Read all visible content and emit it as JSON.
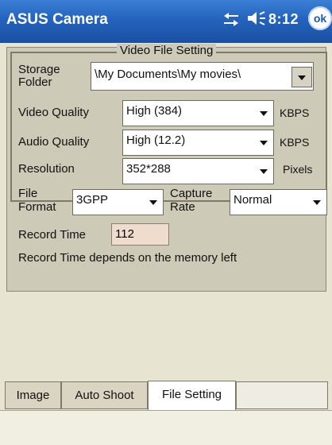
{
  "titlebar": {
    "app_title": "ASUS Camera",
    "clock": "8:12",
    "ok_label": "ok"
  },
  "section_title": "Video File Setting",
  "storage": {
    "label_line1": "Storage",
    "label_line2": "Folder",
    "value": "\\My Documents\\My movies\\"
  },
  "video_quality": {
    "label": "Video Quality",
    "value": "High (384)",
    "unit": "KBPS"
  },
  "audio_quality": {
    "label": "Audio Quality",
    "value": "High (12.2)",
    "unit": "KBPS"
  },
  "resolution": {
    "label": "Resolution",
    "value": "352*288",
    "unit": "Pixels"
  },
  "file_format": {
    "label_line1": "File",
    "label_line2": "Format",
    "value": "3GPP"
  },
  "capture_rate": {
    "label_line1": "Capture",
    "label_line2": "Rate",
    "value": "Normal"
  },
  "record_time": {
    "label": "Record Time",
    "value": "112",
    "note": "Record Time depends on the memory left"
  },
  "tabs": [
    {
      "label": "Image"
    },
    {
      "label": "Auto Shoot"
    },
    {
      "label": "File Setting"
    }
  ]
}
